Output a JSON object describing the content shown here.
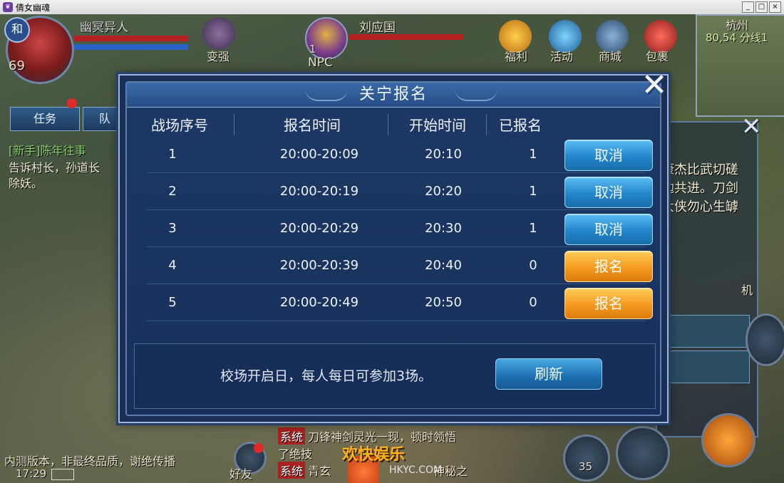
{
  "window": {
    "title": "倩女幽魂"
  },
  "hud": {
    "player_name": "幽冥异人",
    "player_level": "69",
    "faction_badge": "和",
    "target_name": "刘应国",
    "target_level": "1",
    "target_tag": "NPC",
    "top_buttons": [
      "变强",
      "福利",
      "活动",
      "商城",
      "包裹"
    ],
    "map_name": "杭州",
    "map_coords": "80,54 分线1",
    "tabs": [
      "任务",
      "队"
    ],
    "quest_title": "[新手]陈年往事",
    "quest_desc_1": "告诉村长，孙道长",
    "quest_desc_2": "除妖。",
    "right_text_1": "康杰比武切磋",
    "right_text_2": "勉共进。刀剑",
    "right_text_3": "大侠勿心生罅",
    "right_label": "机",
    "chat_tag": "系统",
    "chat_line_1": "刀锋神剑灵光一现，顿时领悟",
    "chat_line_2": "了绝技",
    "chat_line_3": "青玄",
    "chat_line_3_tail": "神秘之",
    "footer_notice": "内测版本，非最终品质，谢绝传播",
    "clock": "17:29",
    "friends_label": "好友",
    "skill_count": "35"
  },
  "dialog": {
    "title": "关宁报名",
    "close_label": "✕",
    "columns": [
      "战场序号",
      "报名时间",
      "开始时间",
      "已报名"
    ],
    "rows": [
      {
        "index": "1",
        "signup_time": "20:00-20:09",
        "start_time": "20:10",
        "registered": "1",
        "action": "取消",
        "action_type": "cancel"
      },
      {
        "index": "2",
        "signup_time": "20:00-20:19",
        "start_time": "20:20",
        "registered": "1",
        "action": "取消",
        "action_type": "cancel"
      },
      {
        "index": "3",
        "signup_time": "20:00-20:29",
        "start_time": "20:30",
        "registered": "1",
        "action": "取消",
        "action_type": "cancel"
      },
      {
        "index": "4",
        "signup_time": "20:00-20:39",
        "start_time": "20:40",
        "registered": "0",
        "action": "报名",
        "action_type": "signup"
      },
      {
        "index": "5",
        "signup_time": "20:00-20:49",
        "start_time": "20:50",
        "registered": "0",
        "action": "报名",
        "action_type": "signup"
      }
    ],
    "note": "校场开启日，每人每日可参加3场。",
    "refresh_label": "刷新"
  },
  "watermark": {
    "main": "欢快娱乐",
    "sub": "HKYC.COM"
  },
  "colors": {
    "cancel": "#2386cc",
    "signup": "#f59a1e",
    "dialog_bg": "#1a2f55"
  }
}
